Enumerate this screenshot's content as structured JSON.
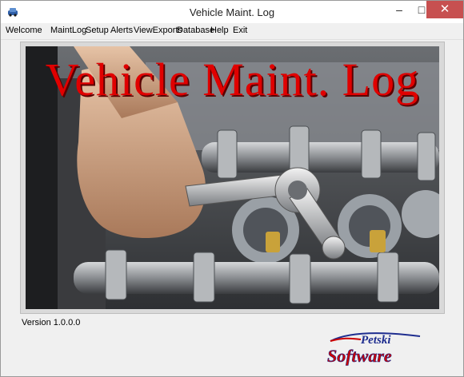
{
  "window": {
    "title": "Vehicle Maint. Log",
    "minimize_glyph": "–",
    "maximize_glyph": "□",
    "close_glyph": "✕"
  },
  "menu": {
    "items": [
      "Welcome",
      "MaintLog",
      "Setup",
      "Alerts",
      "ViewExports",
      "Database",
      "Help",
      "Exit"
    ]
  },
  "banner": {
    "text": "Vehicle Maint. Log"
  },
  "version": "Version 1.0.0.0",
  "logo": {
    "top": "Petski",
    "bottom": "Software"
  },
  "colors": {
    "banner_red": "#e00000",
    "logo_red": "#cc0000",
    "logo_blue": "#1e2d8f",
    "close_button": "#c75050"
  }
}
